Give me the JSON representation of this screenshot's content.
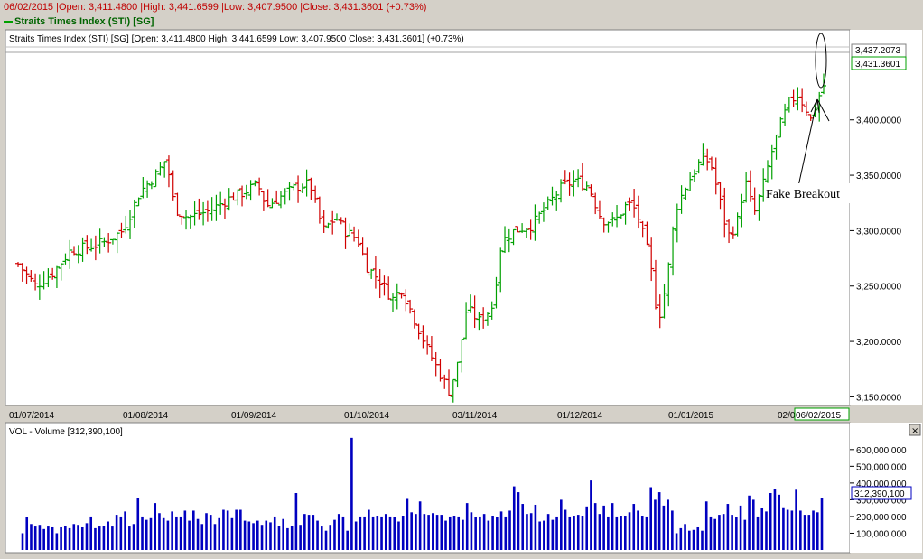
{
  "top_bar": {
    "text": "06/02/2015 |Open: 3,411.4800 |High: 3,441.6599 |Low: 3,407.9500 |Close: 3,431.3601 (+0.73%)"
  },
  "legend": {
    "label": "Straits Times Index (STI) [SG]"
  },
  "price_pane": {
    "header": "Straits Times Index (STI) [SG] [Open: 3,411.4800  High: 3,441.6599  Low: 3,407.9500  Close: 3,431.3601] (+0.73%)",
    "last_price_label": "3,437.2073",
    "close_label": "3,431.3601"
  },
  "volume_pane": {
    "header": "VOL - Volume [312,390,100]",
    "last_label": "312,390,100"
  },
  "annotation": {
    "text": "Fake Breakout"
  },
  "colors": {
    "up": "#00a000",
    "down": "#d00000",
    "volume": "#0000c0",
    "pane_bg": "#ffffff",
    "frame_bg": "#d4d0c8"
  },
  "chart_data": [
    {
      "type": "ohlc",
      "title": "Straits Times Index (STI) [SG]",
      "x_tick_labels": [
        "01/07/2014",
        "01/08/2014",
        "01/09/2014",
        "01/10/2014",
        "03/11/2014",
        "01/12/2014",
        "01/01/2015",
        "02/0",
        "06/02/2015"
      ],
      "y_tick_values": [
        3150,
        3200,
        3250,
        3300,
        3350,
        3400,
        3437.2073
      ],
      "y_tick_labels": [
        "3,150.0000",
        "3,200.0000",
        "3,250.0000",
        "3,300.0000",
        "3,350.0000",
        "3,400.0000",
        "3,437.2073"
      ],
      "ylim": [
        3143,
        3465
      ],
      "grid": false,
      "close_path": [
        [
          0,
          3270
        ],
        [
          4,
          3250
        ],
        [
          8,
          3262
        ],
        [
          12,
          3282
        ],
        [
          16,
          3285
        ],
        [
          20,
          3290
        ],
        [
          24,
          3300
        ],
        [
          28,
          3335
        ],
        [
          32,
          3352
        ],
        [
          34,
          3365
        ],
        [
          36,
          3320
        ],
        [
          39,
          3312
        ],
        [
          44,
          3318
        ],
        [
          48,
          3328
        ],
        [
          52,
          3335
        ],
        [
          55,
          3342
        ],
        [
          57,
          3322
        ],
        [
          60,
          3330
        ],
        [
          64,
          3340
        ],
        [
          67,
          3342
        ],
        [
          70,
          3300
        ],
        [
          73,
          3312
        ],
        [
          75,
          3300
        ],
        [
          78,
          3292
        ],
        [
          80,
          3268
        ],
        [
          83,
          3255
        ],
        [
          86,
          3238
        ],
        [
          88,
          3248
        ],
        [
          91,
          3220
        ],
        [
          94,
          3193
        ],
        [
          97,
          3170
        ],
        [
          99,
          3155
        ],
        [
          101,
          3180
        ],
        [
          103,
          3230
        ],
        [
          106,
          3218
        ],
        [
          109,
          3232
        ],
        [
          111,
          3290
        ],
        [
          114,
          3300
        ],
        [
          118,
          3305
        ],
        [
          121,
          3320
        ],
        [
          125,
          3340
        ],
        [
          128,
          3345
        ],
        [
          131,
          3340
        ],
        [
          134,
          3310
        ],
        [
          137,
          3308
        ],
        [
          140,
          3325
        ],
        [
          142,
          3318
        ],
        [
          145,
          3275
        ],
        [
          147,
          3218
        ],
        [
          149,
          3255
        ],
        [
          151,
          3320
        ],
        [
          154,
          3345
        ],
        [
          157,
          3365
        ],
        [
          159,
          3362
        ],
        [
          161,
          3330
        ],
        [
          163,
          3295
        ],
        [
          165,
          3305
        ],
        [
          167,
          3345
        ],
        [
          169,
          3315
        ],
        [
          171,
          3340
        ],
        [
          173,
          3370
        ],
        [
          175,
          3395
        ],
        [
          177,
          3415
        ],
        [
          179,
          3423
        ],
        [
          181,
          3410
        ],
        [
          182,
          3400
        ],
        [
          184,
          3422
        ],
        [
          185,
          3431
        ]
      ],
      "annotation": "Fake Breakout"
    },
    {
      "type": "bar",
      "title": "VOL - Volume",
      "y_tick_values": [
        100000000,
        200000000,
        300000000,
        400000000,
        500000000,
        600000000
      ],
      "y_tick_labels": [
        "100,000,000",
        "200,000,000",
        "300,000,000",
        "400,000,000",
        "500,000,000",
        "600,000,000"
      ],
      "ylim": [
        0,
        680000000
      ],
      "last_value": 312390100,
      "values": [
        100000000,
        195000000,
        155000000,
        140000000,
        150000000,
        125000000,
        140000000,
        135000000,
        100000000,
        135000000,
        145000000,
        130000000,
        155000000,
        150000000,
        135000000,
        160000000,
        200000000,
        130000000,
        140000000,
        145000000,
        170000000,
        140000000,
        210000000,
        200000000,
        230000000,
        140000000,
        155000000,
        310000000,
        200000000,
        180000000,
        190000000,
        280000000,
        220000000,
        190000000,
        175000000,
        230000000,
        200000000,
        200000000,
        235000000,
        175000000,
        235000000,
        185000000,
        155000000,
        220000000,
        210000000,
        155000000,
        190000000,
        240000000,
        235000000,
        190000000,
        240000000,
        240000000,
        175000000,
        170000000,
        160000000,
        175000000,
        150000000,
        175000000,
        165000000,
        200000000,
        145000000,
        185000000,
        130000000,
        145000000,
        340000000,
        150000000,
        215000000,
        210000000,
        210000000,
        175000000,
        140000000,
        115000000,
        150000000,
        180000000,
        215000000,
        200000000,
        115000000,
        670000000,
        170000000,
        200000000,
        200000000,
        240000000,
        200000000,
        205000000,
        200000000,
        215000000,
        200000000,
        195000000,
        170000000,
        205000000,
        305000000,
        225000000,
        215000000,
        290000000,
        215000000,
        210000000,
        220000000,
        210000000,
        210000000,
        175000000,
        200000000,
        205000000,
        200000000,
        180000000,
        280000000,
        225000000,
        195000000,
        200000000,
        215000000,
        175000000,
        205000000,
        195000000,
        230000000,
        200000000,
        235000000,
        380000000,
        345000000,
        275000000,
        215000000,
        220000000,
        270000000,
        170000000,
        175000000,
        215000000,
        180000000,
        200000000,
        300000000,
        240000000,
        200000000,
        205000000,
        210000000,
        205000000,
        260000000,
        415000000,
        280000000,
        215000000,
        265000000,
        200000000,
        280000000,
        200000000,
        205000000,
        205000000,
        225000000,
        275000000,
        235000000,
        205000000,
        200000000,
        375000000,
        300000000,
        345000000,
        265000000,
        300000000,
        235000000,
        100000000,
        130000000,
        155000000,
        115000000,
        120000000,
        135000000,
        115000000,
        290000000,
        200000000,
        185000000,
        210000000,
        215000000,
        275000000,
        210000000,
        195000000,
        265000000,
        180000000,
        325000000,
        300000000,
        200000000,
        250000000,
        230000000,
        340000000,
        365000000,
        330000000,
        255000000,
        240000000,
        235000000,
        360000000,
        235000000,
        210000000,
        210000000,
        235000000,
        225000000,
        312390100
      ]
    }
  ]
}
